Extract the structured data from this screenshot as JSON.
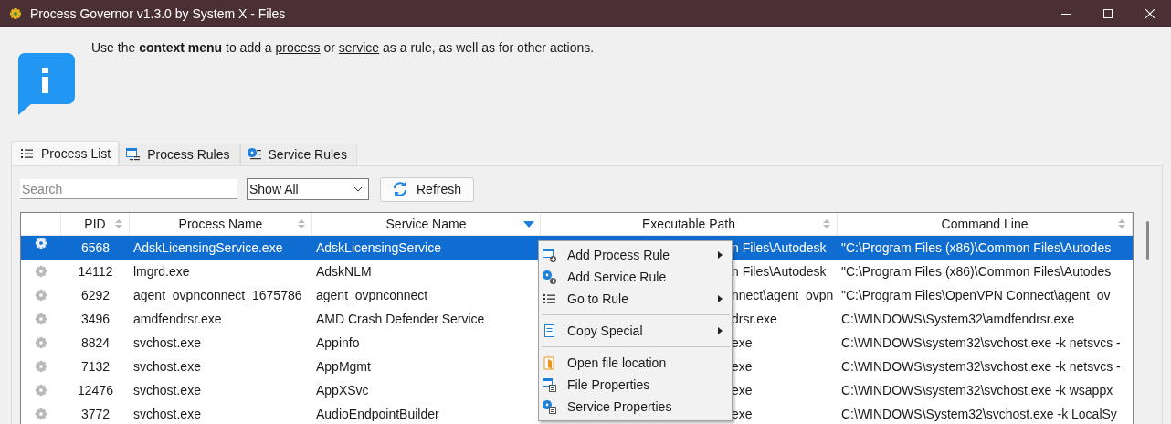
{
  "window": {
    "title": "Process Governor v1.3.0 by System X - Files"
  },
  "info": {
    "segments": [
      {
        "kind": "text",
        "text": "Use the **context menu** to add a "
      },
      {
        "kind": "link",
        "text": "process"
      },
      {
        "kind": "text",
        "text": " or "
      },
      {
        "kind": "link",
        "text": "service"
      },
      {
        "kind": "text",
        "text": " as a rule, as well as for other actions."
      }
    ]
  },
  "tabs": [
    {
      "label": "Process List",
      "selected": true
    },
    {
      "label": "Process Rules",
      "selected": false
    },
    {
      "label": "Service Rules",
      "selected": false
    }
  ],
  "toolbar": {
    "search": {
      "placeholder": "Search"
    },
    "filter": {
      "value": "Show All"
    },
    "refresh": {
      "label": "Refresh"
    }
  },
  "table": {
    "columns": [
      {
        "label": "PID",
        "sorted": false
      },
      {
        "label": "Process Name",
        "sorted": false
      },
      {
        "label": "Service Name",
        "sorted": true
      },
      {
        "label": "Executable Path",
        "sorted": false
      },
      {
        "label": "Command Line",
        "sorted": false
      }
    ],
    "rows": [
      {
        "selected": true,
        "cells": [
          "6568",
          "AdskLicensingService.exe",
          "AdskLicensingService",
          "n Files\\Autodesk",
          "\"C:\\Program Files (x86)\\Common Files\\Autodes"
        ]
      },
      {
        "selected": false,
        "cells": [
          "14112",
          "lmgrd.exe",
          "AdskNLM",
          "n Files\\Autodesk",
          "\"C:\\Program Files (x86)\\Common Files\\Autodes"
        ]
      },
      {
        "selected": false,
        "cells": [
          "6292",
          "agent_ovpnconnect_1675786",
          "agent_ovpnconnect",
          "nnect\\agent_ovpn",
          "\"C:\\Program Files\\OpenVPN Connect\\agent_ov"
        ]
      },
      {
        "selected": false,
        "cells": [
          "3496",
          "amdfendrsr.exe",
          "AMD Crash Defender Service",
          "drsr.exe",
          "C:\\WINDOWS\\System32\\amdfendrsr.exe"
        ]
      },
      {
        "selected": false,
        "cells": [
          "8824",
          "svchost.exe",
          "Appinfo",
          "exe",
          "C:\\WINDOWS\\system32\\svchost.exe -k netsvcs -"
        ]
      },
      {
        "selected": false,
        "cells": [
          "7132",
          "svchost.exe",
          "AppMgmt",
          "exe",
          "C:\\WINDOWS\\system32\\svchost.exe -k netsvcs -"
        ]
      },
      {
        "selected": false,
        "cells": [
          "12476",
          "svchost.exe",
          "AppXSvc",
          "exe",
          "C:\\WINDOWS\\system32\\svchost.exe -k wsappx"
        ]
      },
      {
        "selected": false,
        "cells": [
          "3772",
          "svchost.exe",
          "AudioEndpointBuilder",
          "exe",
          "C:\\WINDOWS\\System32\\svchost.exe -k LocalSy"
        ]
      }
    ]
  },
  "context_menu": {
    "items": [
      {
        "kind": "item",
        "label": "Add Process Rule",
        "submenu": true
      },
      {
        "kind": "item",
        "label": "Add Service Rule",
        "submenu": false
      },
      {
        "kind": "item",
        "label": "Go to Rule",
        "submenu": true
      },
      {
        "kind": "separator"
      },
      {
        "kind": "item",
        "label": "Copy Special",
        "submenu": true
      },
      {
        "kind": "separator"
      },
      {
        "kind": "item",
        "label": "Open file location",
        "submenu": false
      },
      {
        "kind": "item",
        "label": "File Properties",
        "submenu": false
      },
      {
        "kind": "item",
        "label": "Service Properties",
        "submenu": false
      }
    ]
  }
}
